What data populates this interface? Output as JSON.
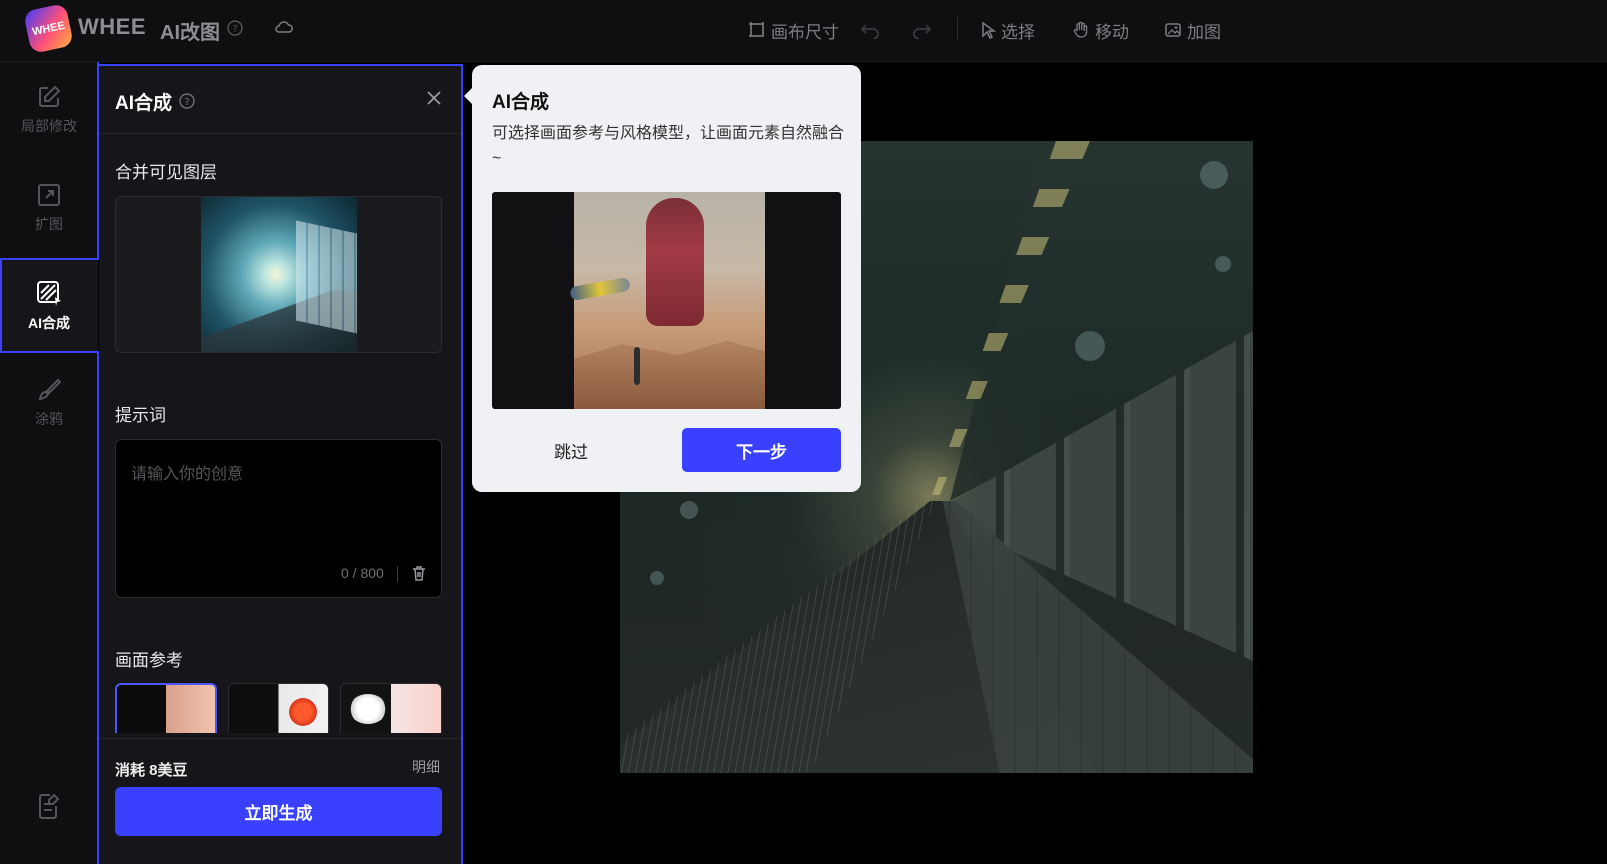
{
  "header": {
    "brand": "WHEE",
    "logo_text": "WHEE",
    "app_title": "AI改图",
    "toolbar": {
      "canvas_size": "画布尺寸",
      "select": "选择",
      "move": "移动",
      "add_image": "加图"
    }
  },
  "rail": {
    "items": [
      {
        "label": "局部修改",
        "icon": "edit-icon"
      },
      {
        "label": "扩图",
        "icon": "expand-icon"
      },
      {
        "label": "AI合成",
        "icon": "ai-compose-icon",
        "active": true
      },
      {
        "label": "涂鸦",
        "icon": "brush-icon"
      }
    ],
    "bottom_icon": "notes-icon"
  },
  "panel": {
    "title": "AI合成",
    "merge_label": "合并可见图层",
    "prompt_label": "提示词",
    "prompt_placeholder": "请输入你的创意",
    "prompt_count": "0 / 800",
    "reference_label": "画面参考",
    "cost": "消耗 8美豆",
    "detail": "明细",
    "generate": "立即生成"
  },
  "popover": {
    "title": "AI合成",
    "description": "可选择画面参考与风格模型，让画面元素自然融合~",
    "skip": "跳过",
    "next": "下一步"
  },
  "colors": {
    "accent": "#3940ff",
    "background": "#000000",
    "panel": "#16161a",
    "popover": "#f0f1f4"
  }
}
